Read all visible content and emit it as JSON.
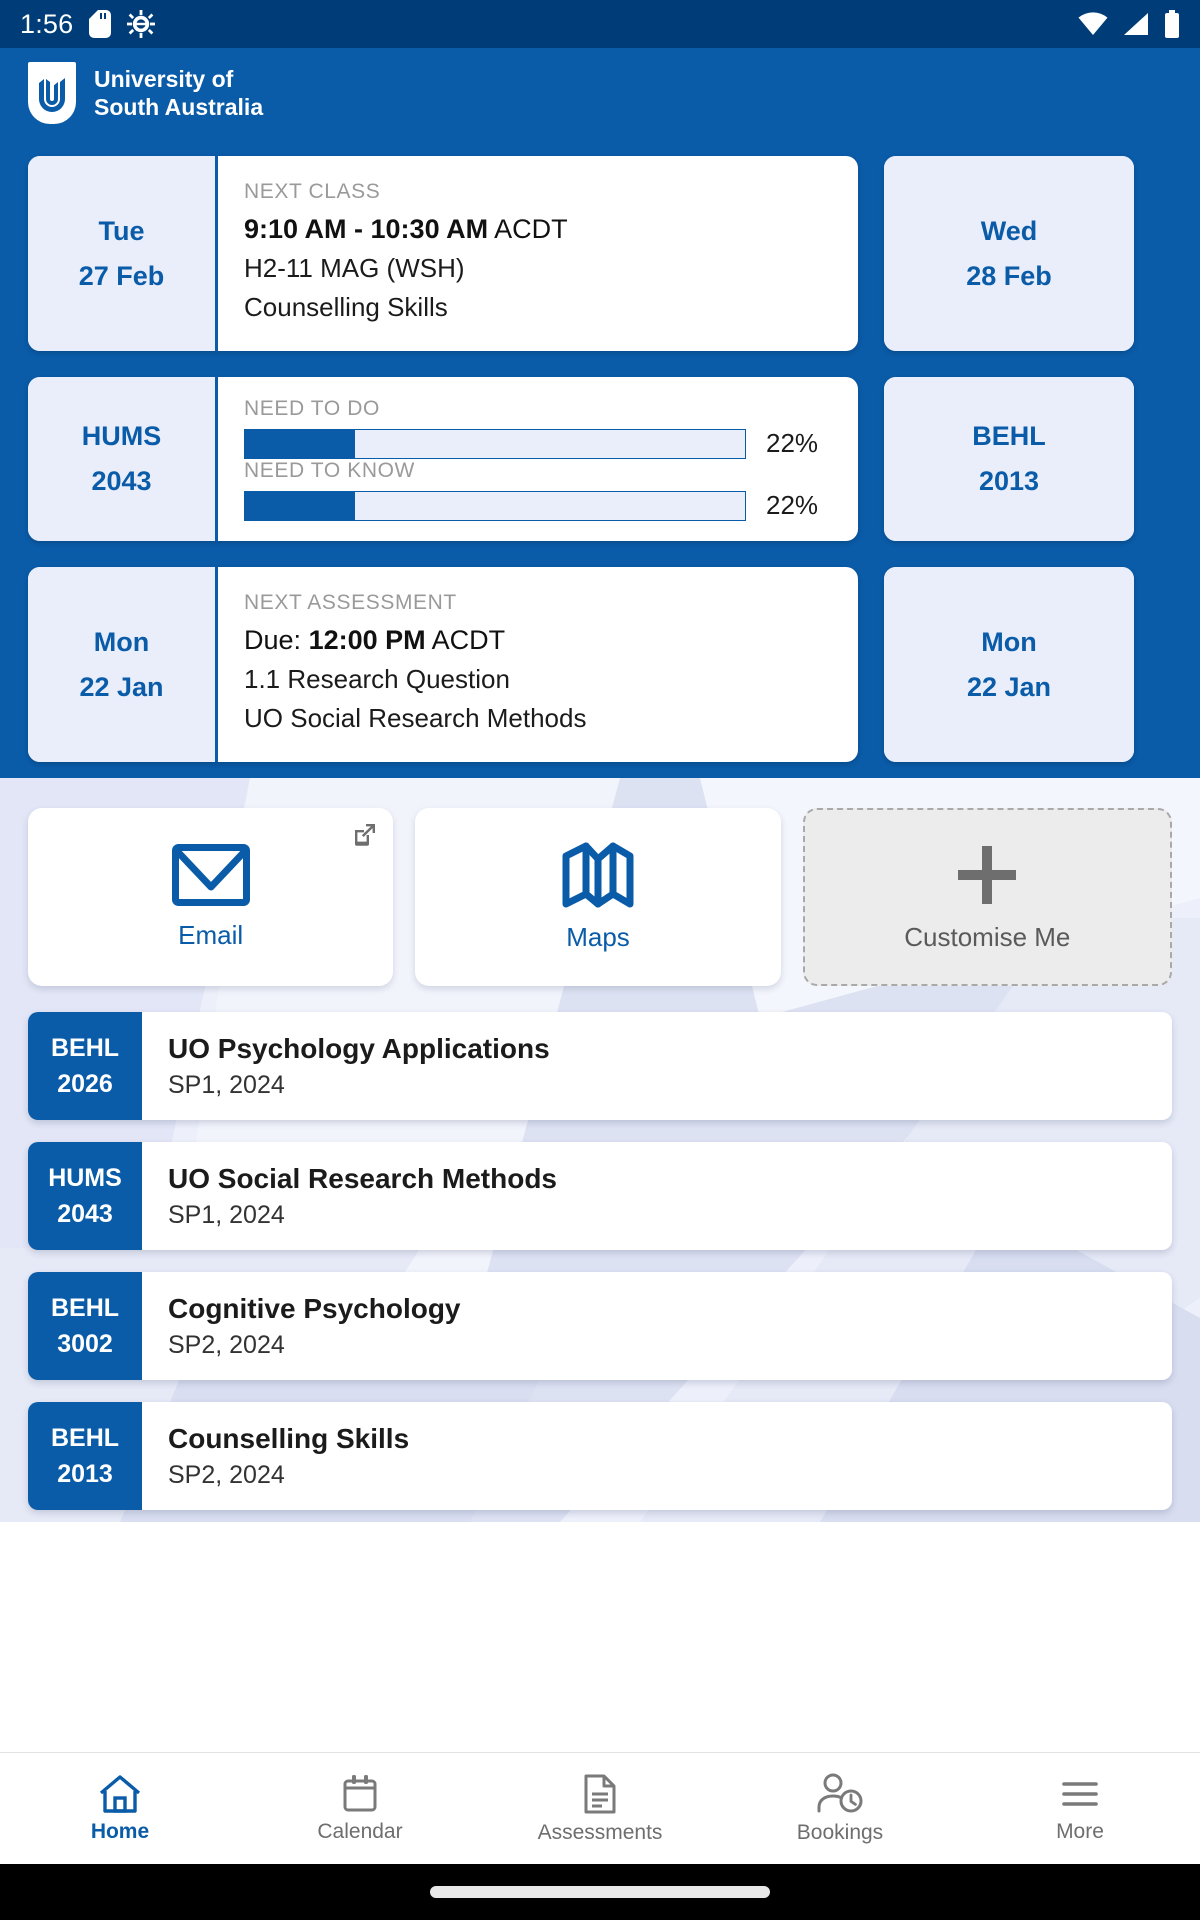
{
  "status_bar": {
    "time": "1:56",
    "icons_left": [
      "sd-card-icon",
      "android-debug-icon"
    ],
    "icons_right": [
      "wifi-icon",
      "cellular-signal-icon",
      "battery-icon"
    ],
    "background_color": "#003D78"
  },
  "app_bar": {
    "logo_name": "unisa-logo",
    "brand_line1": "University of",
    "brand_line2": "South Australia",
    "background_color": "#0A5BA8"
  },
  "widgets": [
    {
      "type": "next-class",
      "date_day": "Tue",
      "date_date": "27 Feb",
      "kicker": "NEXT CLASS",
      "time_bold": "9:10 AM - 10:30 AM",
      "time_zone": "ACDT",
      "location": "H2-11 MAG (WSH)",
      "course": "Counselling Skills",
      "peek": {
        "date_day": "Wed",
        "date_date": "28 Feb"
      }
    },
    {
      "type": "course-progress",
      "code_prefix": "HUMS",
      "code_number": "2043",
      "bars": [
        {
          "label": "NEED TO DO",
          "percent": 22,
          "percent_label": "22%"
        },
        {
          "label": "NEED TO KNOW",
          "percent": 22,
          "percent_label": "22%"
        }
      ],
      "peek": {
        "code_prefix": "BEHL",
        "code_number": "2013"
      }
    },
    {
      "type": "next-assessment",
      "date_day": "Mon",
      "date_date": "22 Jan",
      "kicker": "NEXT ASSESSMENT",
      "due_prefix": "Due:",
      "due_bold": "12:00 PM",
      "due_zone": "ACDT",
      "assessment": "1.1 Research Question",
      "course": "UO Social Research Methods",
      "peek": {
        "date_day": "Mon",
        "date_date": "22 Jan"
      }
    }
  ],
  "quick_tiles": [
    {
      "icon": "envelope-icon",
      "label": "Email",
      "external": true,
      "external_icon": "external-link-icon"
    },
    {
      "icon": "map-icon",
      "label": "Maps",
      "external": false
    },
    {
      "icon": "plus-icon",
      "label": "Customise Me",
      "external": false
    }
  ],
  "courses": [
    {
      "code_prefix": "BEHL",
      "code_number": "2026",
      "name": "UO Psychology Applications",
      "term": "SP1, 2024"
    },
    {
      "code_prefix": "HUMS",
      "code_number": "2043",
      "name": "UO Social Research Methods",
      "term": "SP1, 2024"
    },
    {
      "code_prefix": "BEHL",
      "code_number": "3002",
      "name": "Cognitive Psychology",
      "term": "SP2, 2024"
    },
    {
      "code_prefix": "BEHL",
      "code_number": "2013",
      "name": "Counselling Skills",
      "term": "SP2, 2024"
    }
  ],
  "tab_bar": [
    {
      "icon": "home-icon",
      "label": "Home",
      "active": true
    },
    {
      "icon": "calendar-icon",
      "label": "Calendar",
      "active": false
    },
    {
      "icon": "document-icon",
      "label": "Assessments",
      "active": false
    },
    {
      "icon": "person-clock-icon",
      "label": "Bookings",
      "active": false
    },
    {
      "icon": "hamburger-menu-icon",
      "label": "More",
      "active": false
    }
  ],
  "colors": {
    "brand_blue": "#0A5BA8",
    "status_blue": "#003D78",
    "pale_blue": "#E9EEFA",
    "body_bg": "#E9EDFA",
    "muted_grey": "#9A9A9A"
  }
}
